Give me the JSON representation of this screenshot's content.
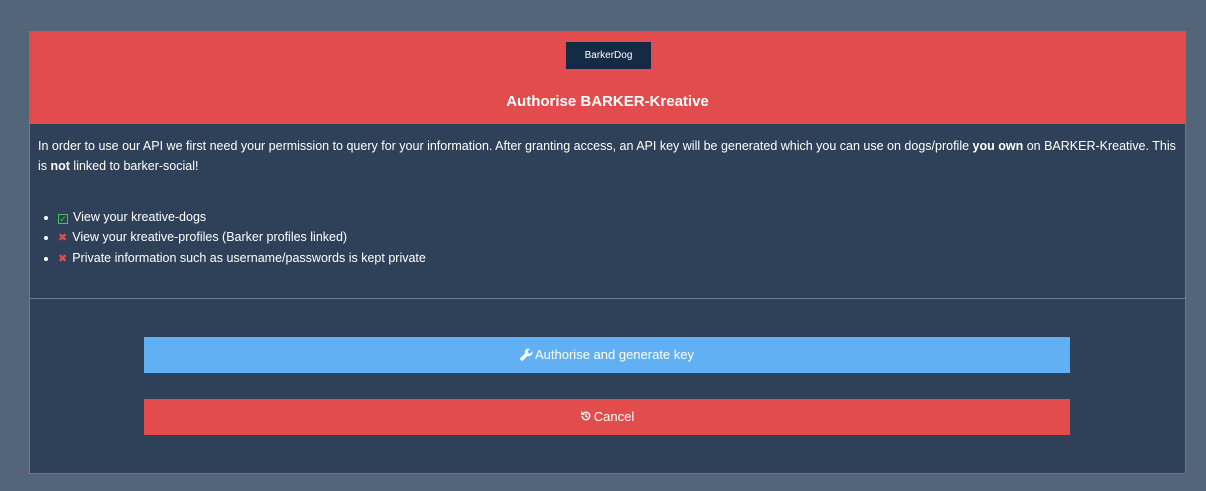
{
  "header": {
    "brand": "BarkerDog",
    "title": "Authorise BARKER-Kreative"
  },
  "intro": {
    "part1": "In order to use our API we first need your permission to query for your information. After granting access, an API key will be generated which you can use on dogs/profile ",
    "bold1": "you own",
    "part2": " on BARKER-Kreative. This is ",
    "bold2": "not",
    "part3": " linked to barker-social!"
  },
  "permissions": [
    {
      "label": "View your kreative-dogs",
      "granted": true,
      "icon": "checkbox-checked-icon"
    },
    {
      "label": "View your kreative-profiles (Barker profiles linked)",
      "granted": false,
      "icon": "cross-icon"
    },
    {
      "label": "Private information such as username/passwords is kept private",
      "granted": false,
      "icon": "cross-icon"
    }
  ],
  "buttons": {
    "authorise": {
      "label": "Authorise and generate key",
      "icon": "wrench-icon"
    },
    "cancel": {
      "label": "Cancel",
      "icon": "history-icon"
    }
  },
  "colors": {
    "background": "#536578",
    "panel": "#2e4158",
    "header": "#e24c4c",
    "primary_button": "#61b0f3",
    "cancel_button": "#e24c4c",
    "badge": "#142a45"
  }
}
